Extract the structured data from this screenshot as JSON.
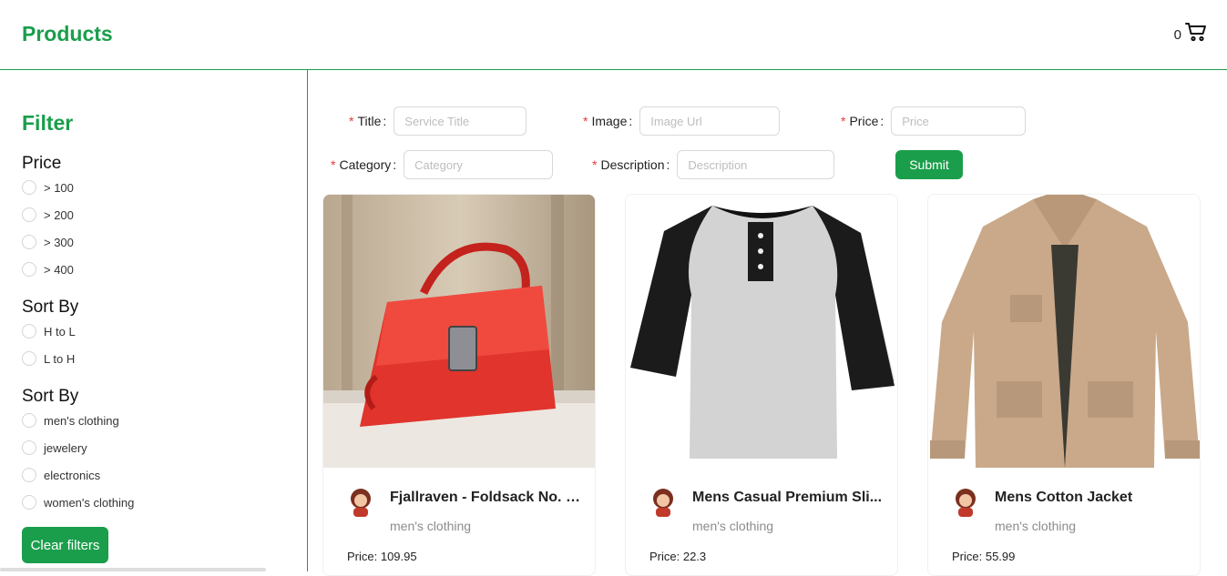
{
  "header": {
    "title": "Products",
    "cart_count": "0"
  },
  "sidebar": {
    "filter_title": "Filter",
    "price_heading": "Price",
    "price_options": [
      "> 100",
      "> 200",
      "> 300",
      "> 400"
    ],
    "sort_heading": "Sort By",
    "sort_options": [
      "H to L",
      "L to H"
    ],
    "category_heading": "Sort By",
    "category_options": [
      "men's clothing",
      "jewelery",
      "electronics",
      "women's clothing"
    ],
    "clear_label": "Clear filters"
  },
  "form": {
    "title_label": "Title",
    "title_placeholder": "Service Title",
    "image_label": "Image",
    "image_placeholder": "Image Url",
    "price_label": "Price",
    "price_placeholder": "Price",
    "category_label": "Category",
    "category_placeholder": "Category",
    "description_label": "Description",
    "description_placeholder": "Description",
    "submit_label": "Submit",
    "required_mark": "*",
    "colon": ":"
  },
  "products": [
    {
      "name": "Fjallraven - Foldsack No. 1...",
      "category": "men's clothing",
      "price": "Price: 109.95",
      "image_icon": "red-handbag-image"
    },
    {
      "name": "Mens Casual Premium Sli...",
      "category": "men's clothing",
      "price": "Price: 22.3",
      "image_icon": "raglan-tshirt-image"
    },
    {
      "name": "Mens Cotton Jacket",
      "category": "men's clothing",
      "price": "Price: 55.99",
      "image_icon": "khaki-jacket-image"
    }
  ],
  "colors": {
    "accent": "#1a9e4b",
    "required": "#e53935"
  }
}
